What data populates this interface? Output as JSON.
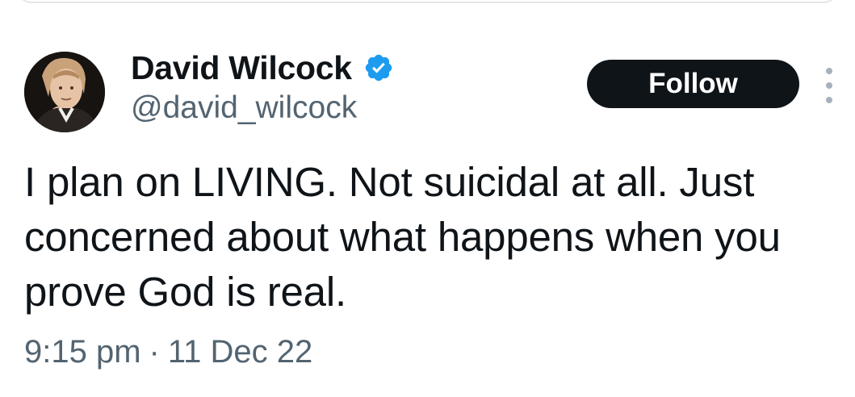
{
  "tweet": {
    "author": {
      "display_name": "David Wilcock",
      "handle": "@david_wilcock",
      "verified": true,
      "verified_color": "#1d9bf0"
    },
    "follow_label": "Follow",
    "text": "I plan on LIVING. Not suicidal at all. Just\nconcerned about what happens when you\nprove God is real.",
    "time": "9:15 pm",
    "separator": "·",
    "date": "11 Dec 22"
  },
  "colors": {
    "primary_text": "#0f1419",
    "secondary_text": "#536471",
    "follow_bg": "#0f1419",
    "follow_text": "#ffffff"
  },
  "icons": {
    "verified": "verified-badge-icon",
    "more": "more-vertical-icon"
  }
}
